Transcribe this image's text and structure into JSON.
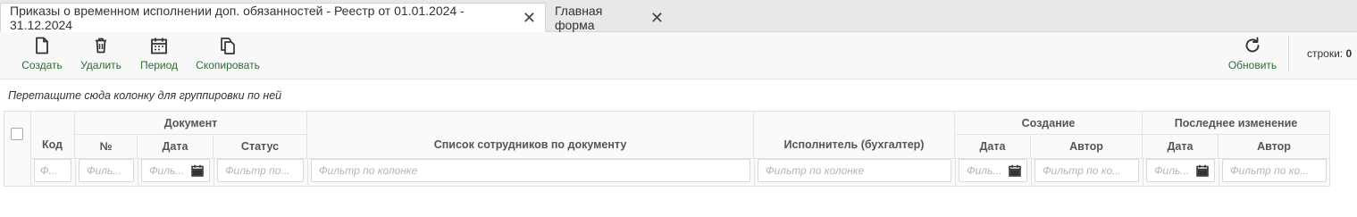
{
  "tabs": [
    {
      "label": "Приказы о временном исполнении доп. обязанностей - Реестр от 01.01.2024 - 31.12.2024",
      "active": true
    },
    {
      "label": "Главная форма",
      "active": false
    }
  ],
  "toolbar": {
    "create": "Создать",
    "delete": "Удалить",
    "period": "Период",
    "copy": "Скопировать",
    "refresh": "Обновить",
    "rows_label": "строки:",
    "rows_count": "0"
  },
  "group_panel": "Перетащите сюда колонку для группировки по ней",
  "grid": {
    "columns": {
      "code": "Код",
      "document": "Документ",
      "doc_number": "№",
      "doc_date": "Дата",
      "doc_status": "Статус",
      "employees": "Список сотрудников по документу",
      "executor": "Исполнитель (бухгалтер)",
      "created": "Создание",
      "created_date": "Дата",
      "created_author": "Автор",
      "modified": "Последнее изменение",
      "modified_date": "Дата",
      "modified_author": "Автор"
    },
    "filters": {
      "code": "Ф...",
      "doc_number": "Филь...",
      "doc_date": "Филь...",
      "doc_status": "Фильтр по...",
      "employees": "Фильтр по колонке",
      "executor": "Фильтр по колонке",
      "created_date": "Филь...",
      "created_author": "Фильтр по ко...",
      "modified_date": "Филь...",
      "modified_author": "Фильтр по ко..."
    }
  },
  "colors": {
    "accent_green": "#2f6b34",
    "tab_bg": "#e8e8e8"
  }
}
